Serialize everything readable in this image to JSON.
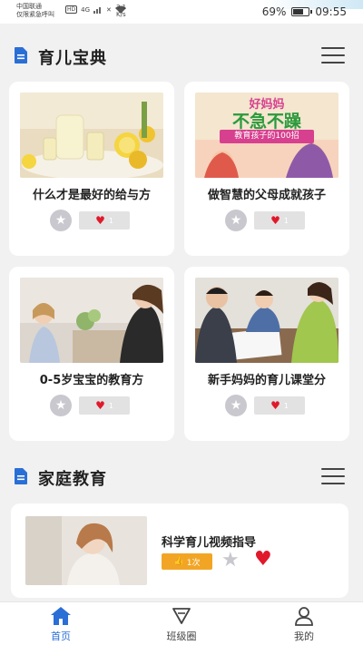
{
  "status_bar": {
    "carrier": "中国联通",
    "emergency": "仅限紧急呼叫",
    "hd_badge": "HD",
    "network": "4G",
    "speed_value": "3.1",
    "speed_unit": "K/s",
    "battery": "69%",
    "battery_level": 0.69,
    "time": "09:55"
  },
  "sections": {
    "parenting": {
      "title": "育儿宝典"
    },
    "family": {
      "title": "家庭教育"
    }
  },
  "articles": [
    {
      "title": "什么才是最好的给与方",
      "likes": "1"
    },
    {
      "title": "做智慧的父母成就孩子",
      "likes": "1"
    },
    {
      "title": "0-5岁宝宝的教育方",
      "likes": "1"
    },
    {
      "title": "新手妈妈的育儿课堂分",
      "likes": "1"
    }
  ],
  "book_cover": {
    "line1": "好妈妈",
    "line2": "不急不躁",
    "line3": "教育孩子的100招"
  },
  "video": {
    "title": "科学育儿视频指导",
    "count": "1次"
  },
  "tabs": [
    {
      "label": "首页"
    },
    {
      "label": "班级圈"
    },
    {
      "label": "我的"
    }
  ],
  "colors": {
    "accent": "#2a6fd6",
    "like_red": "#e0192b",
    "count_orange": "#f2a524"
  }
}
